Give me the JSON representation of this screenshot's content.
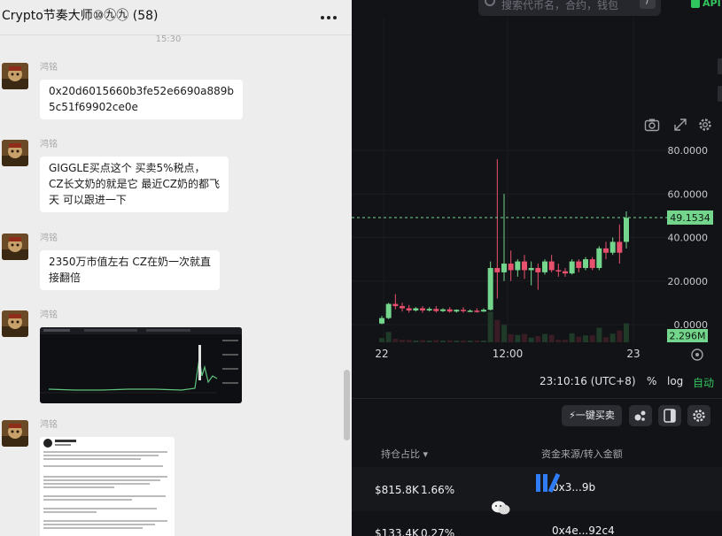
{
  "chat": {
    "title": "Crypto节奏大师⑩㊈㊈ (58)",
    "timestamp": "15:30",
    "messages": [
      {
        "sender": "鸿铭",
        "lines": [
          "0x20d6015660b3fe52e6690a889b",
          "5c51f69902ce0e"
        ]
      },
      {
        "sender": "鸿铭",
        "lines": [
          "GIGGLE买点这个  买卖5%税点，",
          "CZ长文奶的就是它  最近CZ奶的都飞",
          "天  可以跟进一下"
        ]
      },
      {
        "sender": "鸿铭",
        "lines": [
          "2350万市值左右  CZ在奶一次就直",
          "接翻倍"
        ]
      },
      {
        "sender": "鸿铭",
        "image": "chart-screenshot"
      },
      {
        "sender": "鸿铭",
        "image": "tweet-screenshot"
      }
    ]
  },
  "trade": {
    "search_placeholder": "搜索代币名，合约，钱包",
    "search_key": "/",
    "api_label": "API",
    "y_axis_ticks": [
      "80.0000",
      "60.0000",
      "40.0000",
      "20.0000",
      "0.0000"
    ],
    "x_axis_ticks": [
      "22",
      "12:00",
      "23"
    ],
    "current_price": "49.1534",
    "volume_label": "2.296M",
    "time_label": "23:10:16 (UTC+8)",
    "percent_label": "%",
    "log_label": "log",
    "auto_label": "自动",
    "quick_buy": "⚡一键买卖",
    "table_headers": {
      "hold": "持仓占比 ▾",
      "source": "资金来源/转入金额"
    },
    "rows": [
      {
        "value": "$815.8K",
        "pct": "1.66%",
        "addr": "0x3...9b"
      },
      {
        "value": "$133.4K",
        "pct": "0.27%",
        "addr": "0x4e...92c4"
      }
    ],
    "colors": {
      "up": "#74d68c",
      "down": "#e8506e",
      "accent": "#31c55e"
    }
  },
  "chart_data": {
    "type": "candlestick",
    "x_ticks": [
      "22",
      "12:00",
      "23"
    ],
    "y_ticks": [
      0,
      20,
      40,
      60,
      80
    ],
    "ylim": [
      0,
      85
    ],
    "last_price": 49.1534,
    "volume_label": "2.296M",
    "candles": [
      {
        "o": 0.5,
        "h": 4,
        "c": 3.0,
        "l": 0.2
      },
      {
        "o": 3.0,
        "h": 10,
        "c": 9.5,
        "l": 2.5
      },
      {
        "o": 9.5,
        "h": 14,
        "c": 8.5,
        "l": 7
      },
      {
        "o": 8.5,
        "h": 10,
        "c": 7.5,
        "l": 6
      },
      {
        "o": 7.5,
        "h": 9,
        "c": 6.5,
        "l": 5.5
      },
      {
        "o": 6.5,
        "h": 8,
        "c": 7.5,
        "l": 6
      },
      {
        "o": 7.5,
        "h": 8.5,
        "c": 6.5,
        "l": 5.5
      },
      {
        "o": 6.5,
        "h": 8,
        "c": 7.2,
        "l": 6
      },
      {
        "o": 7.2,
        "h": 8.5,
        "c": 6.2,
        "l": 5.5
      },
      {
        "o": 6.2,
        "h": 7.5,
        "c": 7.0,
        "l": 5.8
      },
      {
        "o": 7.0,
        "h": 8,
        "c": 6.0,
        "l": 5.5
      },
      {
        "o": 6.0,
        "h": 7,
        "c": 6.8,
        "l": 5.5
      },
      {
        "o": 6.8,
        "h": 8,
        "c": 6.2,
        "l": 5.5
      },
      {
        "o": 6.2,
        "h": 7,
        "c": 6.4,
        "l": 5.8
      },
      {
        "o": 6.4,
        "h": 7.5,
        "c": 6.0,
        "l": 5.5
      },
      {
        "o": 6.0,
        "h": 7.5,
        "c": 6.8,
        "l": 5.8
      },
      {
        "o": 6.8,
        "h": 29,
        "c": 26,
        "l": 6.5
      },
      {
        "o": 26,
        "h": 76,
        "c": 24,
        "l": 12
      },
      {
        "o": 24,
        "h": 60,
        "c": 28,
        "l": 20
      },
      {
        "o": 28,
        "h": 34,
        "c": 25,
        "l": 20
      },
      {
        "o": 25,
        "h": 30,
        "c": 29,
        "l": 22
      },
      {
        "o": 29,
        "h": 32,
        "c": 25,
        "l": 21
      },
      {
        "o": 25,
        "h": 29,
        "c": 26,
        "l": 18
      },
      {
        "o": 26,
        "h": 28,
        "c": 24,
        "l": 16
      },
      {
        "o": 24,
        "h": 30,
        "c": 29,
        "l": 23
      },
      {
        "o": 29,
        "h": 32,
        "c": 25,
        "l": 24
      },
      {
        "o": 25,
        "h": 28,
        "c": 24.5,
        "l": 22
      },
      {
        "o": 24.5,
        "h": 26,
        "c": 23.5,
        "l": 22
      },
      {
        "o": 23.5,
        "h": 30,
        "c": 29,
        "l": 23
      },
      {
        "o": 29,
        "h": 30,
        "c": 26,
        "l": 24
      },
      {
        "o": 26,
        "h": 31,
        "c": 30,
        "l": 25
      },
      {
        "o": 30,
        "h": 31,
        "c": 26,
        "l": 25
      },
      {
        "o": 26,
        "h": 36,
        "c": 35,
        "l": 25
      },
      {
        "o": 35,
        "h": 38,
        "c": 33,
        "l": 30
      },
      {
        "o": 33,
        "h": 40,
        "c": 38,
        "l": 32
      },
      {
        "o": 38,
        "h": 46,
        "c": 33,
        "l": 28
      },
      {
        "o": 38,
        "h": 52,
        "c": 49,
        "l": 35
      }
    ]
  }
}
